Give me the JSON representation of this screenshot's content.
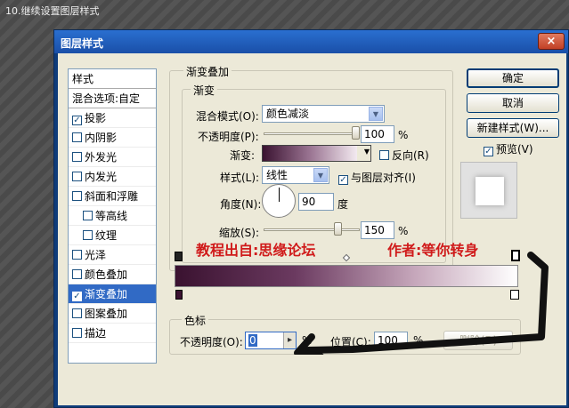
{
  "step_caption": "10.继续设置图层样式",
  "dialog": {
    "title": "图层样式",
    "close": "×"
  },
  "styles_list": {
    "header": "样式",
    "blend_options": "混合选项:自定",
    "items": [
      {
        "label": "投影",
        "checked": true
      },
      {
        "label": "内阴影",
        "checked": false
      },
      {
        "label": "外发光",
        "checked": false
      },
      {
        "label": "内发光",
        "checked": false
      },
      {
        "label": "斜面和浮雕",
        "checked": false
      },
      {
        "label": "等高线",
        "checked": false
      },
      {
        "label": "纹理",
        "checked": false
      },
      {
        "label": "光泽",
        "checked": false
      },
      {
        "label": "颜色叠加",
        "checked": false
      },
      {
        "label": "渐变叠加",
        "checked": true
      },
      {
        "label": "图案叠加",
        "checked": false
      },
      {
        "label": "描边",
        "checked": false
      }
    ]
  },
  "gradient_overlay": {
    "group_title": "渐变叠加",
    "subgroup_title": "渐变",
    "blend_mode_label": "混合模式(O):",
    "blend_mode_value": "颜色减淡",
    "opacity_label": "不透明度(P):",
    "opacity_value": "100",
    "percent": "%",
    "opacity_level": 1.0,
    "gradient_label": "渐变:",
    "reverse_label": "反向(R)",
    "reverse_checked": false,
    "style_label": "样式(L):",
    "style_value": "线性",
    "align_label": "与图层对齐(I)",
    "align_checked": true,
    "angle_label": "角度(N):",
    "angle_value": "90",
    "angle_unit": "度",
    "scale_label": "缩放(S):",
    "scale_value": "150",
    "scale_level": 0.8
  },
  "buttons": {
    "ok": "确定",
    "cancel": "取消",
    "new_style": "新建样式(W)...",
    "preview_label": "预览(V)",
    "preview_checked": true
  },
  "overlay": {
    "source_text": "教程出自:思缘论坛",
    "author_text": "作者:等你转身"
  },
  "color_stops": {
    "group_title": "色标",
    "opacity_label": "不透明度(O):",
    "opacity_value": "0",
    "percent": "%",
    "location_label": "位置(C):",
    "location_value": "100",
    "delete_label": "删除(D)"
  },
  "icon_glyphs": {
    "checkmark": "✓",
    "arrow_down": "▼",
    "arrow_right": "▸"
  }
}
